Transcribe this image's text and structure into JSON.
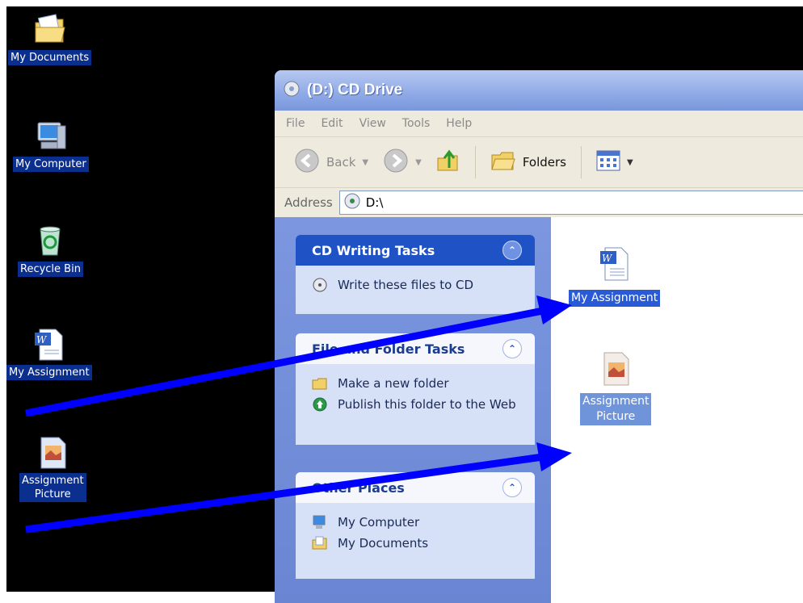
{
  "desktop": {
    "icons": [
      {
        "label": "My Documents",
        "icon": "my-documents-icon"
      },
      {
        "label": "My Computer",
        "icon": "my-computer-icon"
      },
      {
        "label": "Recycle Bin",
        "icon": "recycle-bin-icon"
      },
      {
        "label": "My Assignment",
        "icon": "word-document-icon"
      },
      {
        "label_line1": "Assignment",
        "label_line2": "Picture",
        "icon": "image-file-icon"
      }
    ]
  },
  "window": {
    "title": "(D:) CD Drive",
    "menu": [
      "File",
      "Edit",
      "View",
      "Tools",
      "Help"
    ],
    "toolbar": {
      "back": "Back",
      "folders": "Folders"
    },
    "address": {
      "label": "Address",
      "value": "D:\\"
    },
    "tasks": {
      "cd_writing": {
        "title": "CD Writing Tasks",
        "items": [
          "Write these files to CD"
        ]
      },
      "file_folder": {
        "title": "File and Folder Tasks",
        "items": [
          "Make a new folder",
          "Publish this folder to the Web"
        ]
      },
      "other_places": {
        "title": "Other Places",
        "items": [
          "My Computer",
          "My Documents"
        ]
      }
    },
    "files": [
      {
        "label": "My Assignment",
        "icon": "word-document-icon"
      },
      {
        "label_line1": "Assignment",
        "label_line2": "Picture",
        "icon": "image-file-icon"
      }
    ]
  },
  "colors": {
    "arrow": "#0000ff",
    "desktop_bg": "#000000",
    "selection": "#2a5bd7"
  }
}
